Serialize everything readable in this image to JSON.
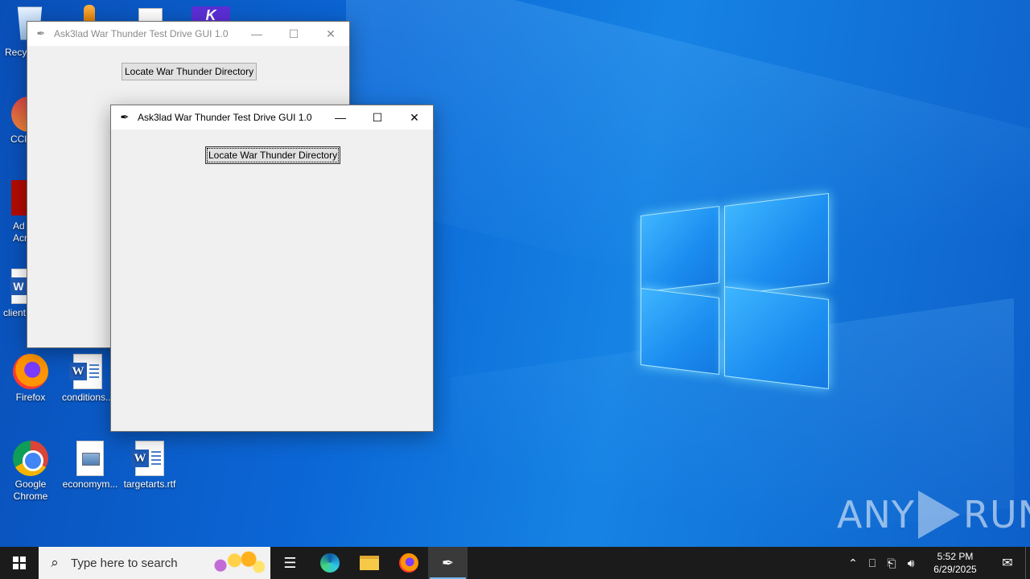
{
  "desktop": {
    "icons": [
      {
        "label": "Recy"
      },
      {
        "label": "CCl"
      },
      {
        "label": "Ad Acr"
      },
      {
        "label": "client"
      },
      {
        "label": "Firefox"
      },
      {
        "label": "conditions..."
      },
      {
        "label": "Google Chrome"
      },
      {
        "label": "economym..."
      },
      {
        "label": "targetarts.rtf"
      }
    ],
    "watermark": {
      "left": "ANY",
      "right": "RUN"
    }
  },
  "window_back": {
    "title": "Ask3lad War Thunder Test Drive GUI 1.0",
    "button_label": "Locate War Thunder Directory"
  },
  "window_front": {
    "title": "Ask3lad War Thunder Test Drive GUI 1.0",
    "button_label": "Locate War Thunder Directory"
  },
  "taskbar": {
    "search_placeholder": "Type here to search",
    "time": "5:52 PM",
    "date": "6/29/2025"
  },
  "colors": {
    "desktop_blue": "#0b67d6",
    "taskbar": "#1b1b1b",
    "window_bg": "#f0f0f0"
  }
}
